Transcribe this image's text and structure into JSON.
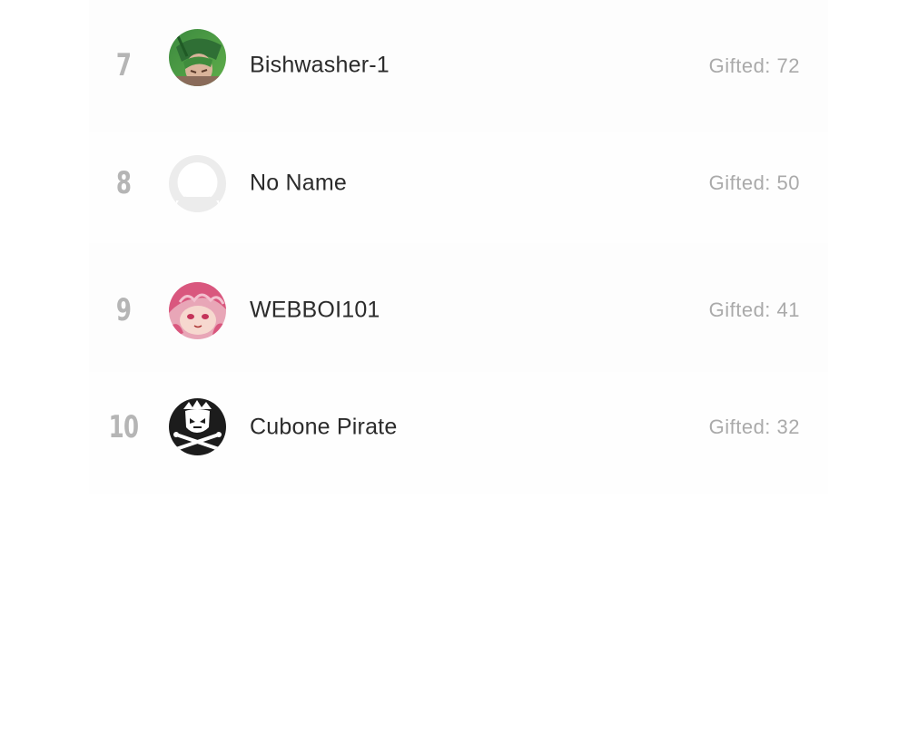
{
  "leaderboard": {
    "rows": [
      {
        "rank": "7",
        "name": "Bishwasher-1",
        "gifted": "Gifted: 72",
        "avatar_icon": "anime-green-hair-avatar-icon"
      },
      {
        "rank": "8",
        "name": "No Name",
        "gifted": "Gifted: 50",
        "avatar_icon": "default-user-avatar-icon"
      },
      {
        "rank": "9",
        "name": "WEBBOI101",
        "gifted": "Gifted: 41",
        "avatar_icon": "anime-pink-hair-avatar-icon"
      },
      {
        "rank": "10",
        "name": "Cubone Pirate",
        "gifted": "Gifted: 32",
        "avatar_icon": "skull-crossbones-avatar-icon"
      }
    ]
  },
  "colors": {
    "rank": "#b5b5b5",
    "name": "#2b2b2b",
    "gifted": "#aaaaaa",
    "row_bg": "#fdfdfd",
    "page_bg": "#ffffff"
  }
}
